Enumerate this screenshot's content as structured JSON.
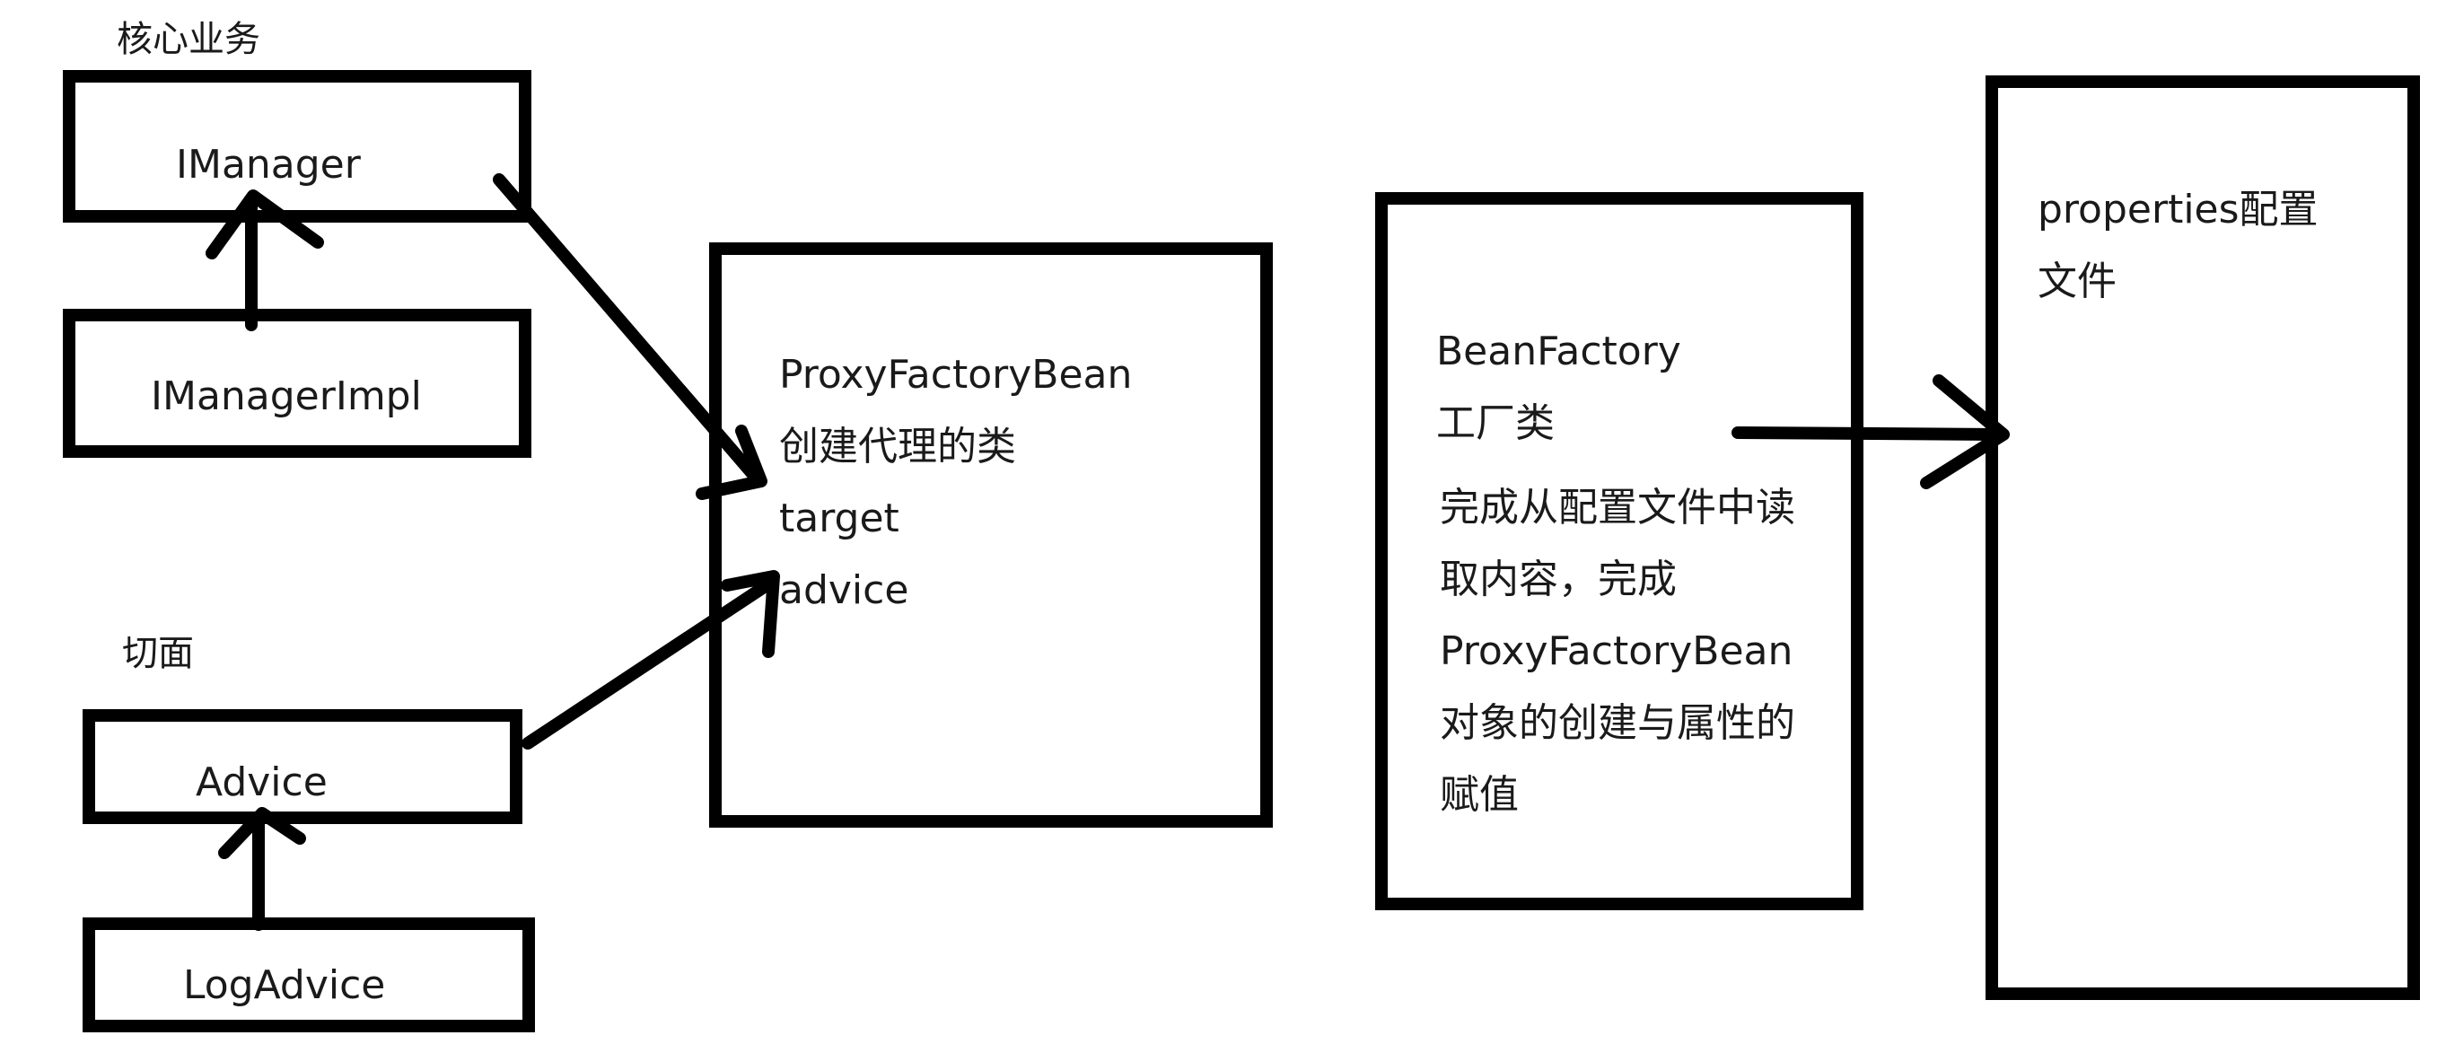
{
  "captions": {
    "core_business": "核心业务",
    "aspect": "切面"
  },
  "boxes": {
    "imanager": "IManager",
    "imanager_impl": "IManagerImpl",
    "advice": "Advice",
    "log_advice": "LogAdvice"
  },
  "proxy_factory_bean": {
    "lines": [
      "ProxyFactoryBean",
      "创建代理的类",
      "target",
      "advice"
    ]
  },
  "bean_factory": {
    "title_lines": [
      "BeanFactory",
      "工厂类"
    ],
    "description_lines": [
      "完成从配置文件中读",
      "取内容，完成",
      "ProxyFactoryBean",
      "对象的创建与属性的",
      "赋值"
    ]
  },
  "properties_file": {
    "lines": [
      "properties配置",
      "文件"
    ]
  },
  "colors": {
    "stroke": "#000000",
    "text": "#1a1a1a",
    "background": "#ffffff"
  }
}
